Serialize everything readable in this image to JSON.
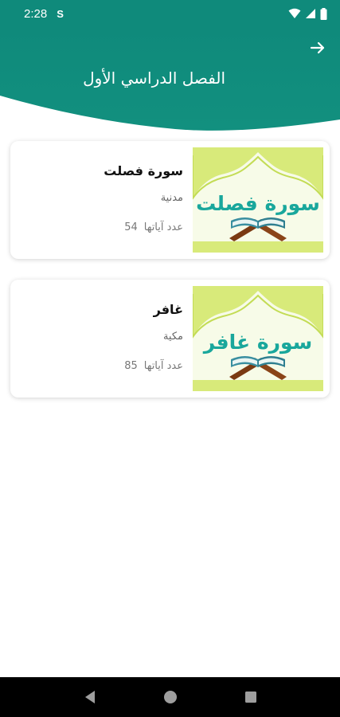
{
  "status_bar": {
    "time": "2:28",
    "indicator": "S",
    "icons": [
      "wifi-icon",
      "signal-icon",
      "battery-icon"
    ]
  },
  "header": {
    "title": "الفصل الدراسي الأول",
    "back_icon": "arrow-right-icon",
    "color": "#0f8a7b"
  },
  "surahs": [
    {
      "name": "سورة فصلت",
      "type": "مدنية",
      "verses_label": "عدد آياتها",
      "verses_count": "54",
      "image_label": "سورة فصلت"
    },
    {
      "name": "غافر",
      "type": "مكية",
      "verses_label": "عدد آياتها",
      "verses_count": "85",
      "image_label": "سورة غافر"
    }
  ],
  "nav_bar": {
    "buttons": [
      "back-triangle-icon",
      "home-circle-icon",
      "recents-square-icon"
    ]
  },
  "colors": {
    "accent": "#0f8a7b",
    "thumb_text": "#19a79c",
    "thumb_frame": "#d8ea7a"
  }
}
